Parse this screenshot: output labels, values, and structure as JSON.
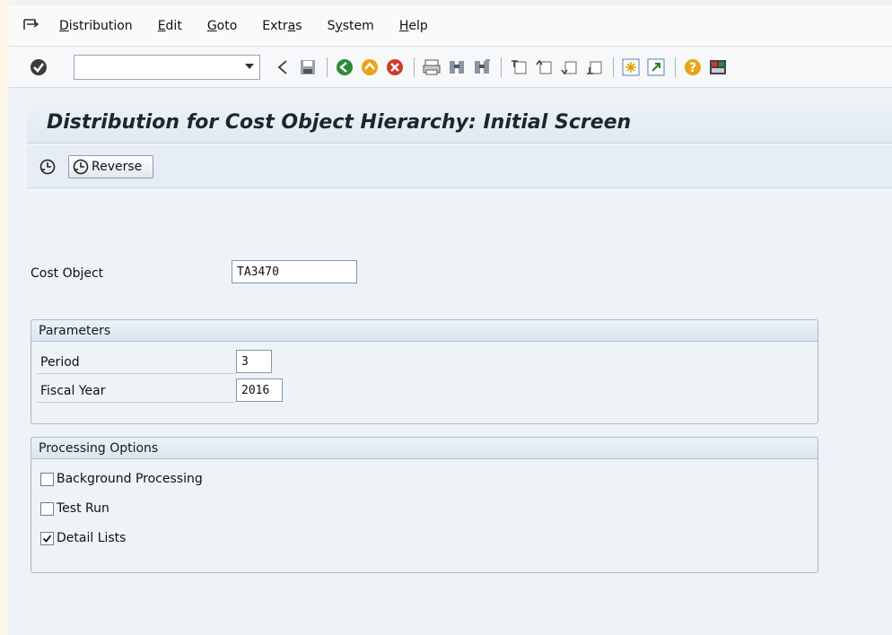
{
  "menu": {
    "items": [
      {
        "u": "D",
        "rest": "istribution"
      },
      {
        "u": "E",
        "rest": "dit"
      },
      {
        "u": "G",
        "rest": "oto"
      },
      {
        "pre": "Extr",
        "u": "a",
        "rest": "s"
      },
      {
        "pre": "S",
        "u": "y",
        "rest": "stem"
      },
      {
        "u": "H",
        "rest": "elp"
      }
    ]
  },
  "toolbar": {
    "command_field_value": ""
  },
  "screen": {
    "title": "Distribution for Cost Object Hierarchy: Initial Screen",
    "reverse_label": "Reverse"
  },
  "form": {
    "cost_object_label": "Cost Object",
    "cost_object_value": "TA3470",
    "parameters": {
      "title": "Parameters",
      "period_label": "Period",
      "period_value": "3",
      "fiscal_year_label": "Fiscal Year",
      "fiscal_year_value": "2016"
    },
    "processing": {
      "title": "Processing Options",
      "background_label": "Background Processing",
      "background_checked": false,
      "test_run_label": "Test Run",
      "test_run_checked": false,
      "detail_lists_label": "Detail Lists",
      "detail_lists_checked": true
    }
  },
  "colors": {
    "accent_green": "#2e8b2e",
    "toolbar_green": "#2a8a3a",
    "cancel_red": "#d23a2a"
  }
}
